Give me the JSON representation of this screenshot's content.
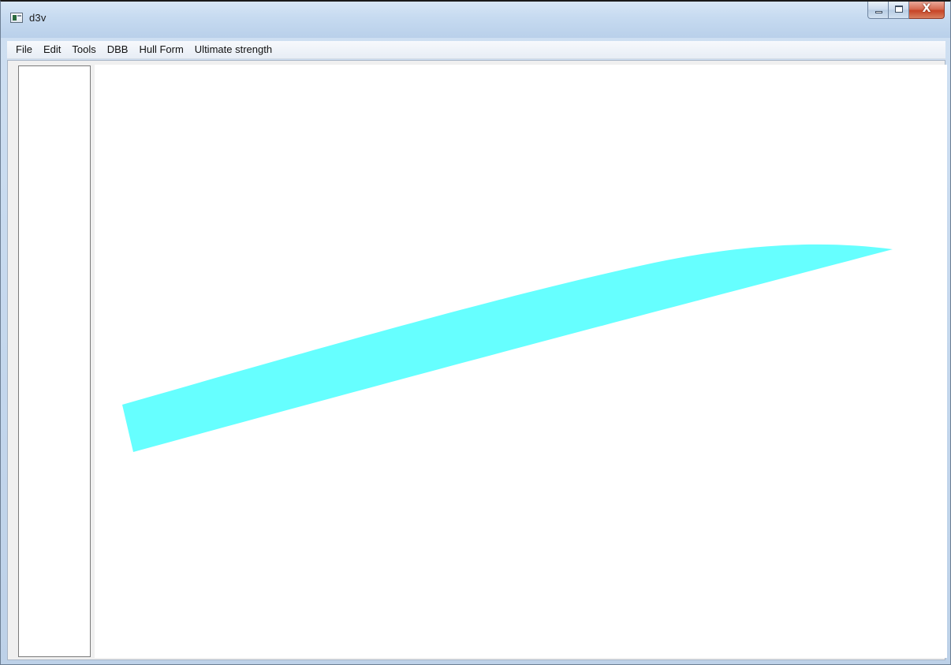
{
  "window": {
    "title": "d3v",
    "close_symbol": "X"
  },
  "menu": {
    "items": [
      "File",
      "Edit",
      "Tools",
      "DBB",
      "Hull Form",
      "Ultimate strength"
    ]
  },
  "viewport": {
    "shape_color": "#66ffff",
    "background_color": "#ffffff"
  },
  "icons": {
    "app": "app-window-icon",
    "minimize": "minimize-icon",
    "maximize": "maximize-icon",
    "close": "close-icon"
  }
}
